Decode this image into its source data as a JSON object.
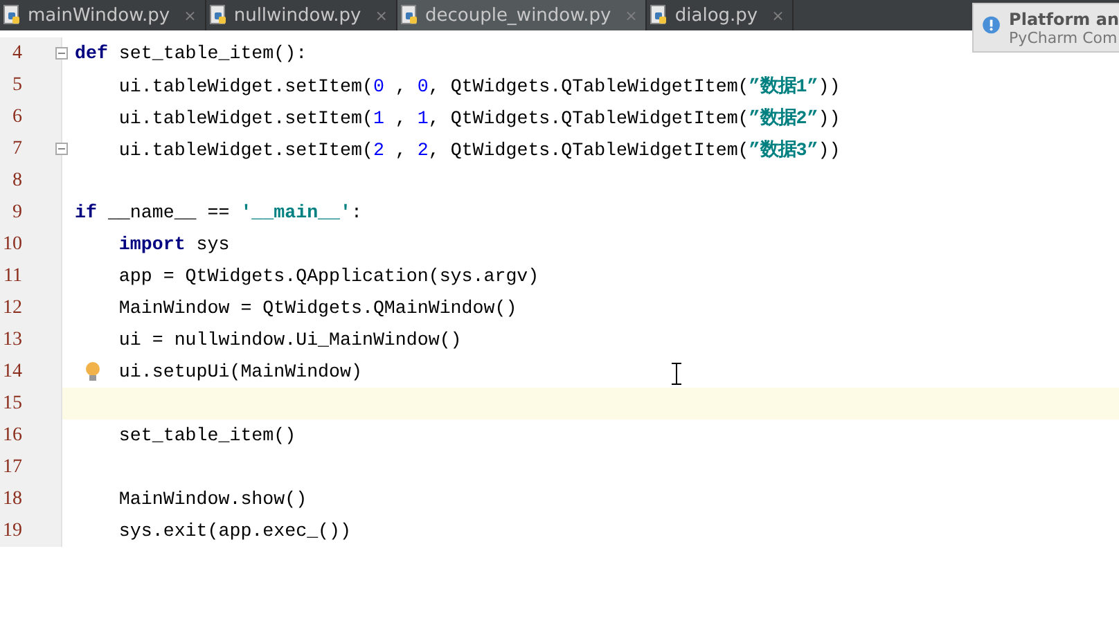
{
  "tabs": [
    {
      "label": "mainWindow.py",
      "close": "×",
      "selected": false
    },
    {
      "label": "nullwindow.py",
      "close": "×",
      "selected": false
    },
    {
      "label": "decouple_window.py",
      "close": "×",
      "selected": true
    },
    {
      "label": "dialog.py",
      "close": "×",
      "selected": false
    }
  ],
  "notification": {
    "title": "Platform an",
    "subtitle": "PyCharm Com"
  },
  "lines": [
    {
      "number": "4",
      "kind": "fold",
      "current": false,
      "tokens": [
        {
          "kind": "keyword",
          "text": "def"
        },
        {
          "kind": "plain",
          "text": " set_table_item():"
        }
      ]
    },
    {
      "number": "5",
      "kind": "plain",
      "current": false,
      "tokens": [
        {
          "kind": "plain",
          "text": "    ui.tableWidget.setItem("
        },
        {
          "kind": "number",
          "text": "0"
        },
        {
          "kind": "plain",
          "text": " , "
        },
        {
          "kind": "number",
          "text": "0"
        },
        {
          "kind": "plain",
          "text": ", QtWidgets.QTableWidgetItem("
        },
        {
          "kind": "string",
          "text": "”数据1”"
        },
        {
          "kind": "plain",
          "text": "))"
        }
      ]
    },
    {
      "number": "6",
      "kind": "plain",
      "current": false,
      "tokens": [
        {
          "kind": "plain",
          "text": "    ui.tableWidget.setItem("
        },
        {
          "kind": "number",
          "text": "1"
        },
        {
          "kind": "plain",
          "text": " , "
        },
        {
          "kind": "number",
          "text": "1"
        },
        {
          "kind": "plain",
          "text": ", QtWidgets.QTableWidgetItem("
        },
        {
          "kind": "string",
          "text": "”数据2”"
        },
        {
          "kind": "plain",
          "text": "))"
        }
      ]
    },
    {
      "number": "7",
      "kind": "fold",
      "current": false,
      "tokens": [
        {
          "kind": "plain",
          "text": "    ui.tableWidget.setItem("
        },
        {
          "kind": "number",
          "text": "2"
        },
        {
          "kind": "plain",
          "text": " , "
        },
        {
          "kind": "number",
          "text": "2"
        },
        {
          "kind": "plain",
          "text": ", QtWidgets.QTableWidgetItem("
        },
        {
          "kind": "string",
          "text": "”数据3”"
        },
        {
          "kind": "plain",
          "text": "))"
        }
      ]
    },
    {
      "number": "8",
      "kind": "plain",
      "current": false
    },
    {
      "number": "9",
      "kind": "plain",
      "current": false,
      "tokens": [
        {
          "kind": "keyword",
          "text": "if"
        },
        {
          "kind": "plain",
          "text": " __name__ == "
        },
        {
          "kind": "string",
          "text": "'__main__'"
        },
        {
          "kind": "plain",
          "text": ":"
        }
      ]
    },
    {
      "number": "10",
      "kind": "plain",
      "current": false,
      "tokens": [
        {
          "kind": "keyword",
          "text": "    import"
        },
        {
          "kind": "plain",
          "text": " sys"
        }
      ]
    },
    {
      "number": "11",
      "kind": "plain",
      "current": false,
      "tokens": [
        {
          "kind": "plain",
          "text": "    app = QtWidgets.QApplication(sys.argv)"
        }
      ]
    },
    {
      "number": "12",
      "kind": "plain",
      "current": false,
      "tokens": [
        {
          "kind": "plain",
          "text": "    MainWindow = QtWidgets.QMainWindow()"
        }
      ]
    },
    {
      "number": "13",
      "kind": "plain",
      "current": false,
      "tokens": [
        {
          "kind": "plain",
          "text": "    ui = nullwindow.Ui_MainWindow()"
        }
      ]
    },
    {
      "number": "14",
      "kind": "bulb",
      "current": false,
      "tokens": [
        {
          "kind": "plain",
          "text": "    ui.setupUi(MainWindow)"
        }
      ]
    },
    {
      "number": "15",
      "kind": "plain",
      "current": true
    },
    {
      "number": "16",
      "kind": "plain",
      "current": false,
      "tokens": [
        {
          "kind": "plain",
          "text": "    set_table_item()"
        }
      ]
    },
    {
      "number": "17",
      "kind": "plain",
      "current": false
    },
    {
      "number": "18",
      "kind": "plain",
      "current": false,
      "tokens": [
        {
          "kind": "plain",
          "text": "    MainWindow.show()"
        }
      ]
    },
    {
      "number": "19",
      "kind": "plain",
      "current": false,
      "tokens": [
        {
          "kind": "plain",
          "text": "    sys.exit(app.exec_())"
        }
      ]
    }
  ]
}
